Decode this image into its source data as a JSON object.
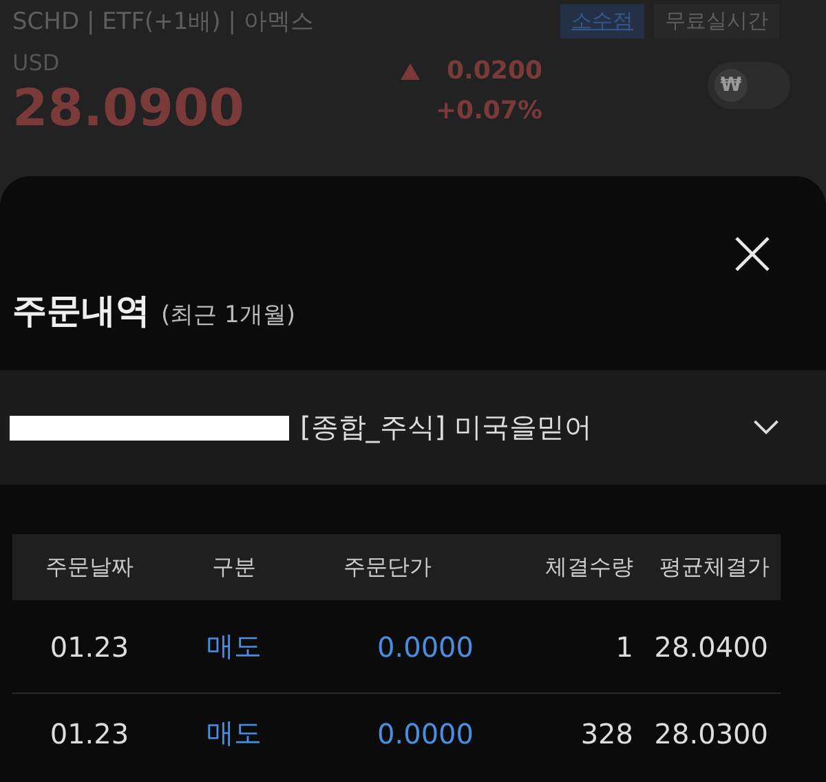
{
  "quote": {
    "symbol_line": "SCHD | ETF(+1배) | 아멕스",
    "tabs": [
      {
        "label": "소수점",
        "selected": true
      },
      {
        "label": "무료실시간",
        "selected": false
      }
    ],
    "currency": "USD",
    "price": "28.0900",
    "change": "0.0200",
    "change_percent": "+0.07%",
    "won_toggle": {
      "label": "₩",
      "on": false
    }
  },
  "sheet": {
    "title": "주문내역",
    "subtitle": "(최근 1개월)",
    "account": {
      "redacted": true,
      "name": "[종합_주식] 미국을믿어"
    },
    "table": {
      "columns": [
        "주문날짜",
        "구분",
        "주문단가",
        "체결수량",
        "평균체결가"
      ],
      "rows": [
        [
          "01.23",
          "매도",
          "0.0000",
          "1",
          "28.0400"
        ],
        [
          "01.23",
          "매도",
          "0.0000",
          "328",
          "28.0300"
        ]
      ]
    }
  }
}
